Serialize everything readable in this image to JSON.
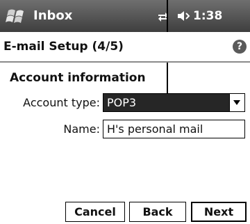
{
  "titlebar": {
    "app_title": "Inbox",
    "clock": "1:38",
    "start_icon": "windows-flag-icon",
    "connectivity_icon": "connectivity-icon",
    "volume_icon": "speaker-icon"
  },
  "heading": {
    "title": "E-mail Setup (4/5)",
    "help_glyph": "?"
  },
  "section": {
    "title": "Account information"
  },
  "fields": {
    "account_type_label": "Account type:",
    "account_type_value": "POP3",
    "name_label": "Name:",
    "name_value": "H's personal mail"
  },
  "buttons": {
    "cancel": "Cancel",
    "back": "Back",
    "next": "Next"
  },
  "colors": {
    "titlebar": "#4a4a4a",
    "selected_combo": "#262626",
    "background": "#ffffff"
  }
}
